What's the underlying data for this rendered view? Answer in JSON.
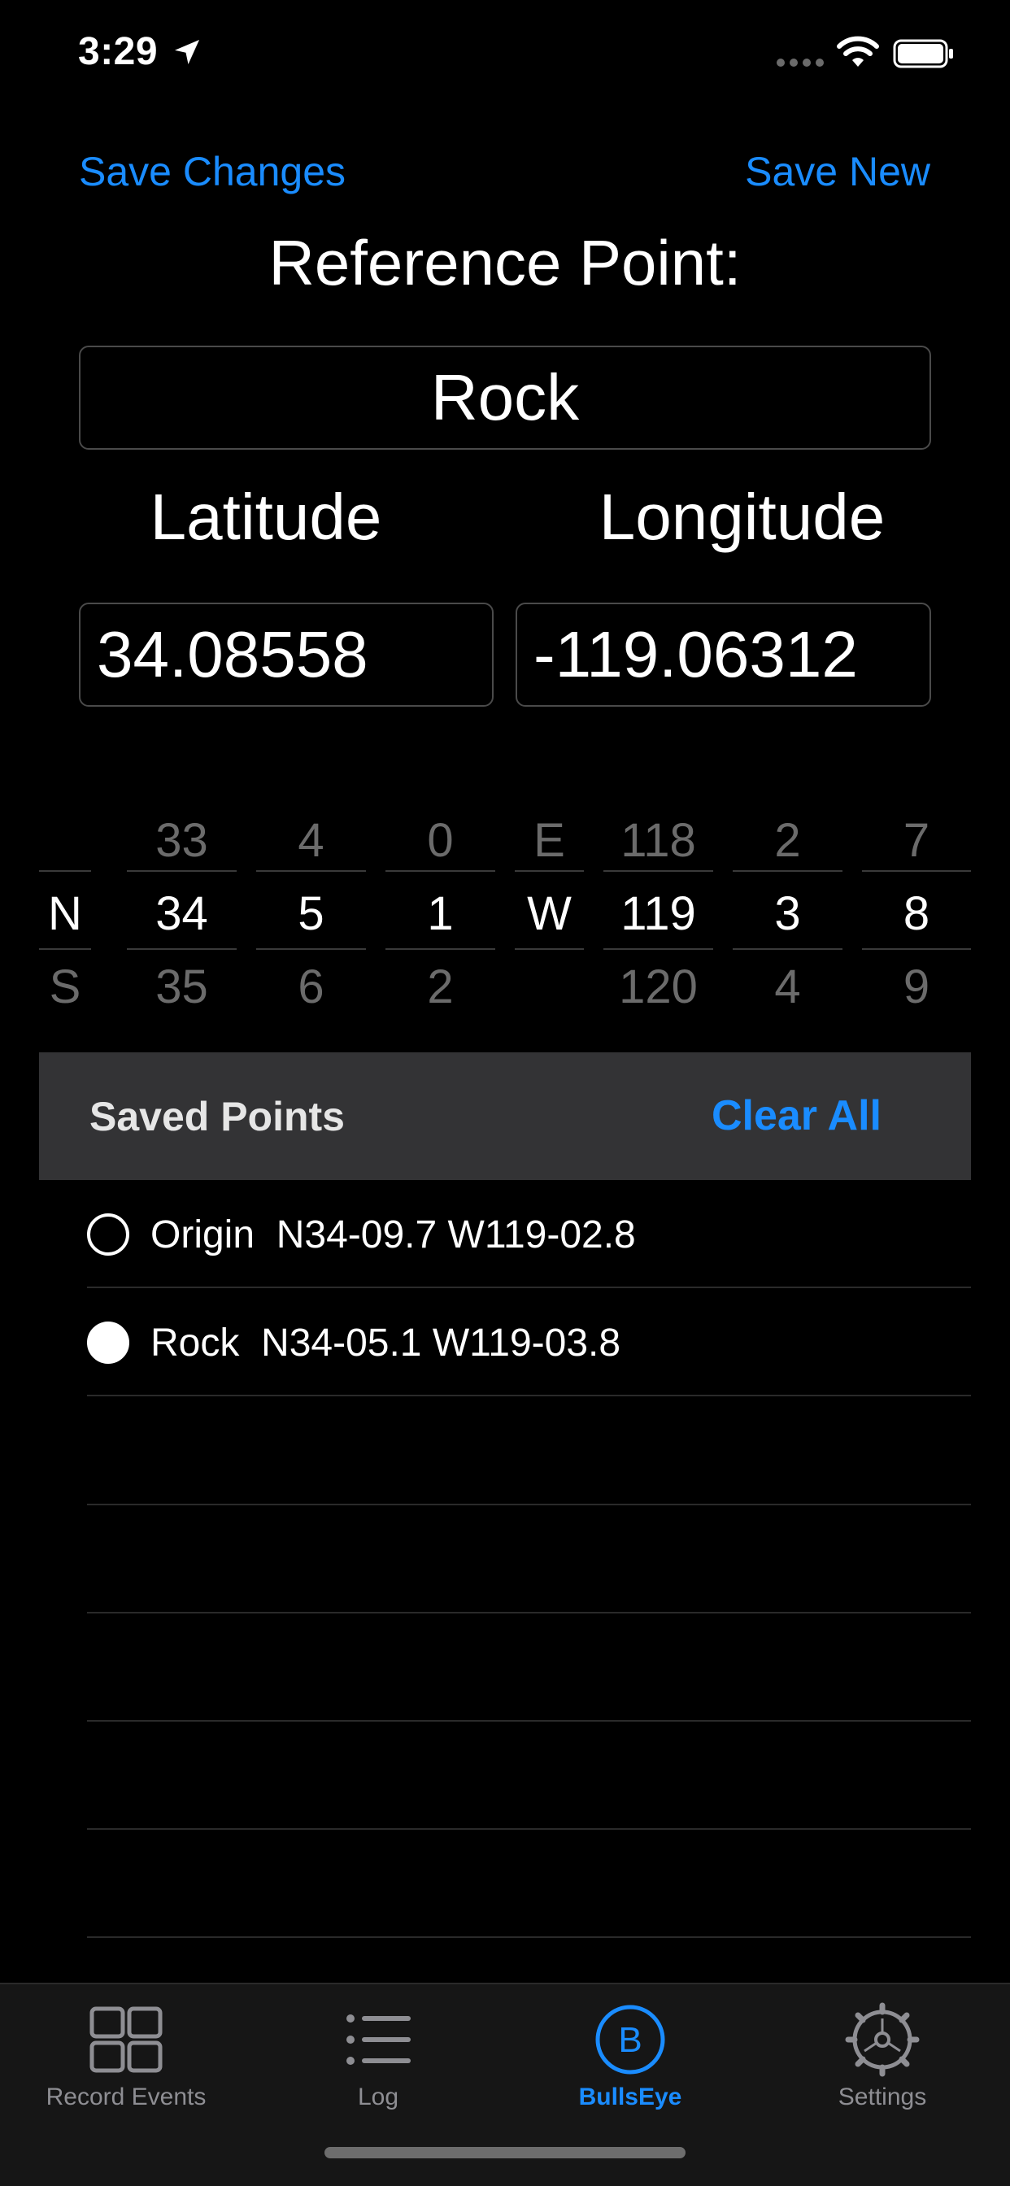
{
  "status": {
    "time": "3:29"
  },
  "nav": {
    "save_changes": "Save Changes",
    "save_new": "Save New"
  },
  "reference": {
    "title": "Reference Point:",
    "name": "Rock"
  },
  "coords": {
    "latitude_label": "Latitude",
    "longitude_label": "Longitude",
    "latitude_value": "34.08558",
    "longitude_value": "-119.06312"
  },
  "picker": {
    "columns": [
      {
        "above": "",
        "selected": "N",
        "below": "S"
      },
      {
        "above": "33",
        "selected": "34",
        "below": "35"
      },
      {
        "above": "4",
        "selected": "5",
        "below": "6"
      },
      {
        "above": "0",
        "selected": "1",
        "below": "2"
      },
      {
        "above": "E",
        "selected": "W",
        "below": ""
      },
      {
        "above": "118",
        "selected": "119",
        "below": "120"
      },
      {
        "above": "2",
        "selected": "3",
        "below": "4"
      },
      {
        "above": "7",
        "selected": "8",
        "below": "9"
      }
    ]
  },
  "saved_points": {
    "title": "Saved Points",
    "clear_all": "Clear All",
    "items": [
      {
        "label": "Origin  N34-09.7 W119-02.8",
        "selected": false
      },
      {
        "label": "Rock  N34-05.1 W119-03.8",
        "selected": true
      }
    ]
  },
  "tabs": [
    {
      "label": "Record Events",
      "icon": "grid-icon",
      "active": false
    },
    {
      "label": "Log",
      "icon": "list-icon",
      "active": false
    },
    {
      "label": "BullsEye",
      "icon": "bullseye-b-icon",
      "active": true
    },
    {
      "label": "Settings",
      "icon": "gear-icon",
      "active": false
    }
  ],
  "colors": {
    "accent": "#1a8cff",
    "background": "#000000",
    "header_bg": "#333335",
    "tabbar_bg": "#161616",
    "inactive": "#8e8e93"
  }
}
